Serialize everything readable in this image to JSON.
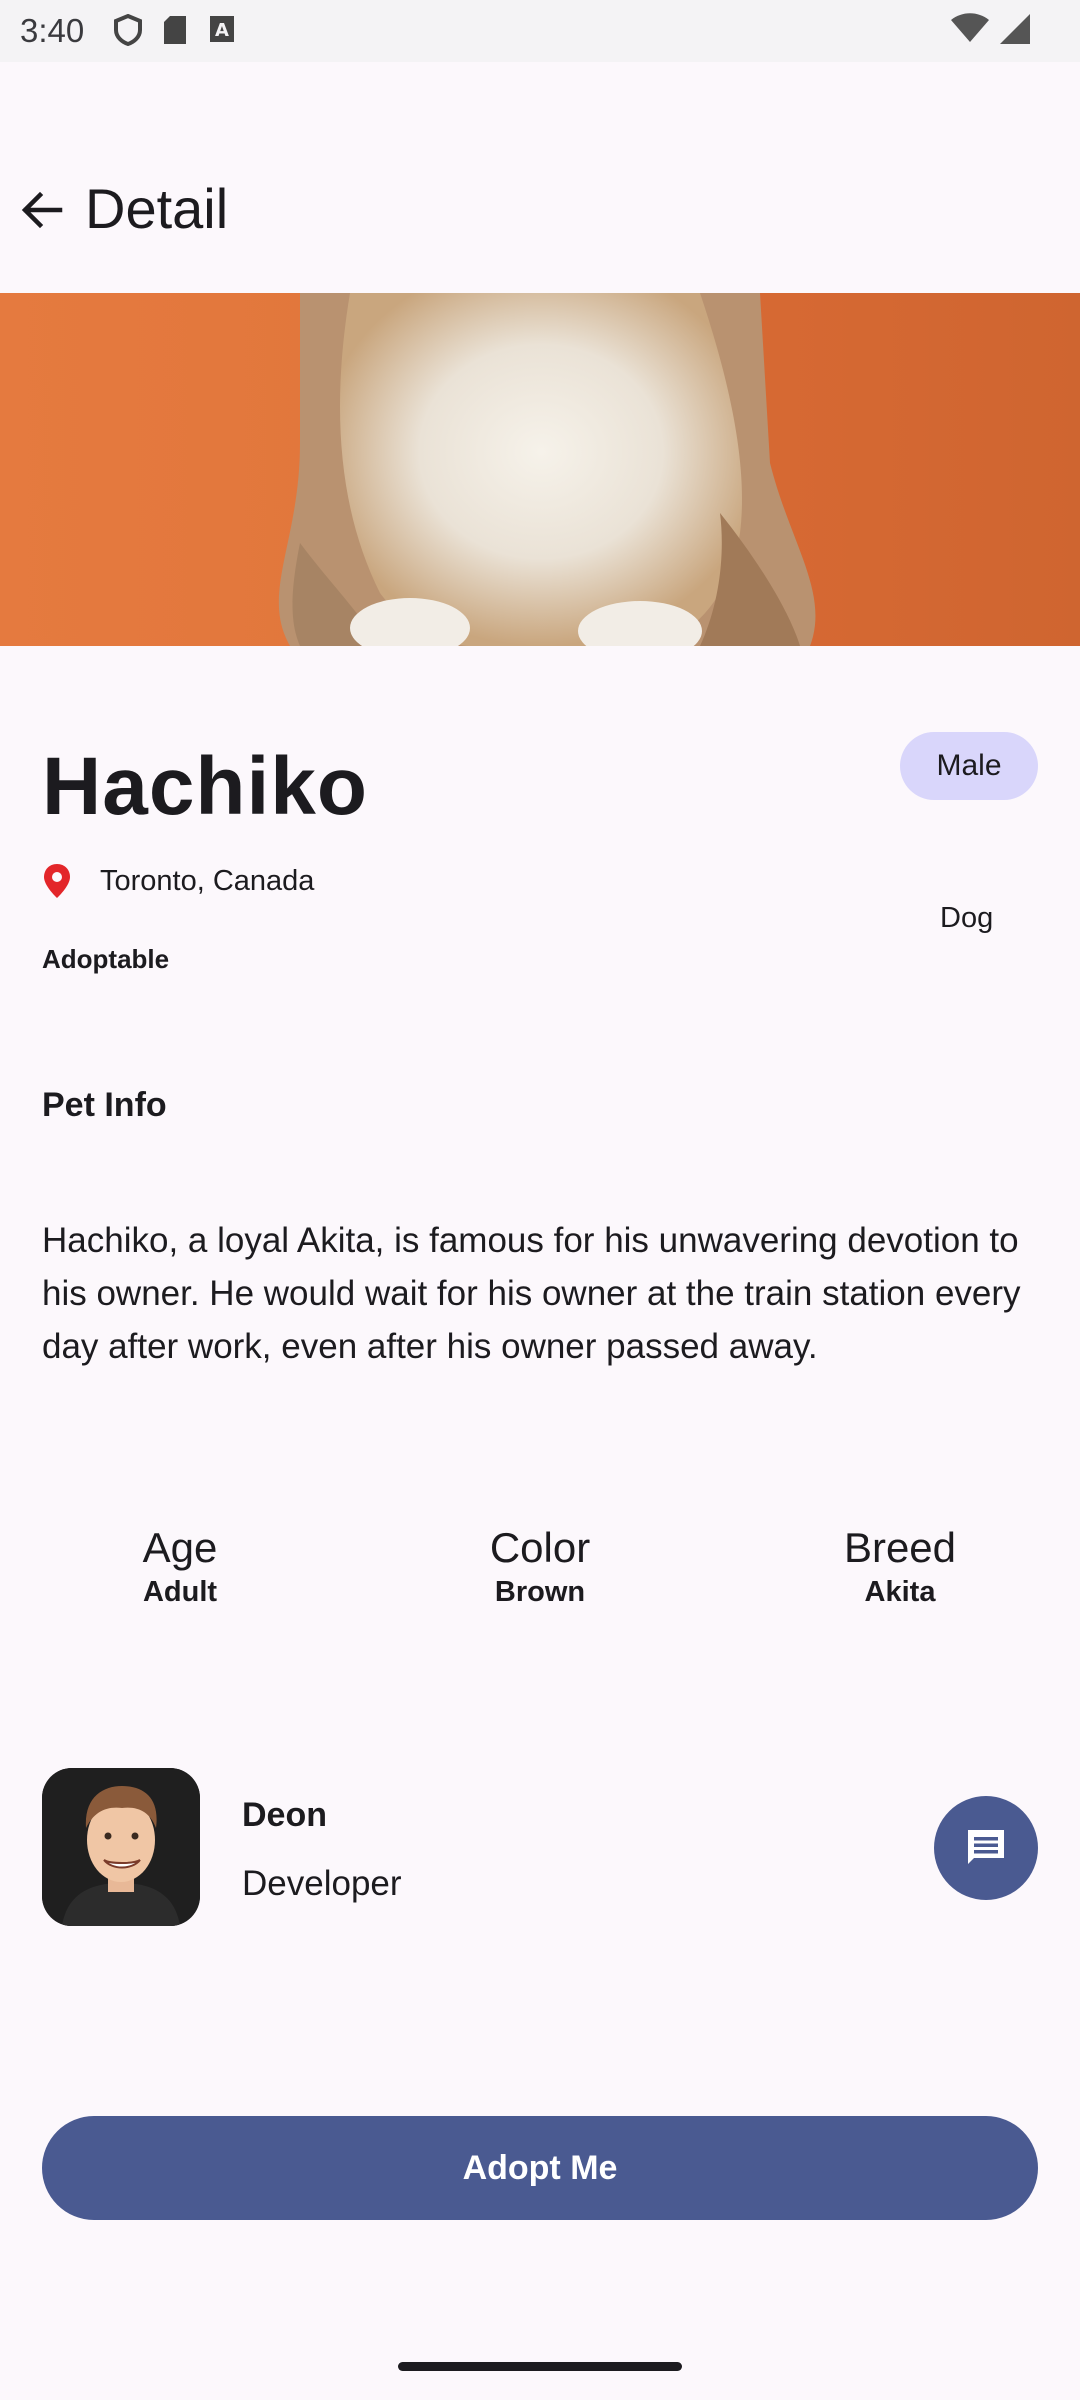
{
  "status_bar": {
    "time": "3:40",
    "left_icons": [
      "shield-icon",
      "sd-card-icon",
      "keyboard-a-icon"
    ],
    "right_icons": [
      "wifi-icon",
      "cell-signal-icon"
    ]
  },
  "app_bar": {
    "title": "Detail",
    "back_icon": "arrow-back-icon"
  },
  "pet": {
    "name": "Hachiko",
    "gender": "Male",
    "location": "Toronto, Canada",
    "species": "Dog",
    "status": "Adoptable",
    "colors": {
      "chip_bg": "#d9d6fb",
      "location_pin": "#e3262a",
      "hero_bg": "#e2773c"
    }
  },
  "info": {
    "section_title": "Pet Info",
    "description": "Hachiko, a loyal Akita, is famous for his unwavering devotion to his owner. He would wait for his owner at the train station every day after work, even after his owner passed away.",
    "attributes": [
      {
        "label": "Age",
        "value": "Adult"
      },
      {
        "label": "Color",
        "value": "Brown"
      },
      {
        "label": "Breed",
        "value": "Akita"
      }
    ]
  },
  "owner": {
    "name": "Deon",
    "role": "Developer",
    "chat_icon": "message-icon"
  },
  "actions": {
    "adopt_label": "Adopt Me",
    "accent_color": "#4a5a91"
  }
}
